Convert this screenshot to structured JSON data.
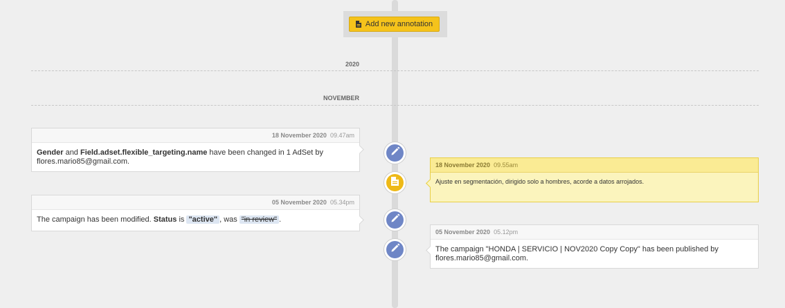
{
  "toolbar": {
    "add_annotation_label": "Add new annotation"
  },
  "dividers": {
    "year": "2020",
    "month": "NOVEMBER"
  },
  "events": [
    {
      "date": "18 November 2020",
      "time": "09.47am",
      "body": {
        "field1": "Gender",
        "and": " and ",
        "field2": "Field.adset.flexible_targeting.name",
        "rest": " have been changed in 1 AdSet by flores.mario85@gmail.com."
      }
    },
    {
      "date": "18 November 2020",
      "time": "09.55am",
      "body": "Ajuste en segmentación, dirigido solo a hombres, acorde a datos arrojados."
    },
    {
      "date": "05 November 2020",
      "time": "05.34pm",
      "body": {
        "prefix": "The campaign has been modified. ",
        "field": "Status",
        "is": " is ",
        "new_value": "\"active\"",
        "was": ", was ",
        "old_value": "\"in review\"",
        "suffix": "."
      }
    },
    {
      "date": "05 November 2020",
      "time": "05.12pm",
      "body": "The campaign \"HONDA | SERVICIO | NOV2020 Copy Copy\" has been published by flores.mario85@gmail.com."
    }
  ],
  "icons": {
    "edit": "pencil-icon",
    "note": "document-icon"
  },
  "colors": {
    "accent_yellow": "#f5c31b",
    "edit_node": "#6f86c6",
    "note_node": "#eeb917",
    "note_bg": "#fbf4bd"
  }
}
